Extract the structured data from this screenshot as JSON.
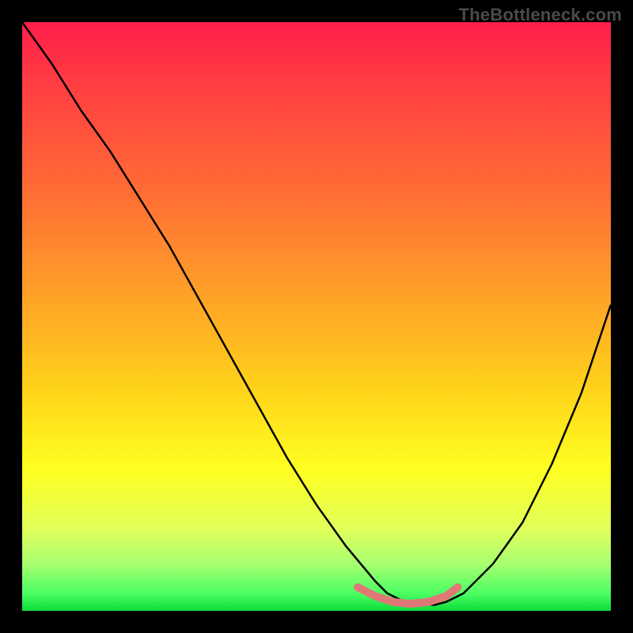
{
  "watermark": "TheBottleneck.com",
  "chart_data": {
    "type": "line",
    "title": "",
    "xlabel": "",
    "ylabel": "",
    "xlim": [
      0,
      100
    ],
    "ylim": [
      0,
      100
    ],
    "grid": false,
    "legend": false,
    "notes": "Axes, ticks and labels are not rendered; values estimated from pixel positions within the gradient plot area.",
    "series": [
      {
        "name": "bottleneck-curve",
        "x": [
          0,
          5,
          10,
          15,
          20,
          25,
          30,
          35,
          40,
          45,
          50,
          55,
          60,
          62,
          65,
          70,
          72,
          75,
          80,
          85,
          90,
          95,
          100
        ],
        "y": [
          100,
          93,
          85,
          78,
          70,
          62,
          53,
          44,
          35,
          26,
          18,
          11,
          5,
          3,
          1.5,
          1,
          1.5,
          3,
          8,
          15,
          25,
          37,
          52
        ]
      }
    ],
    "confidence_band": {
      "name": "optimal-range",
      "x": [
        57,
        60,
        63,
        66,
        69,
        72,
        74
      ],
      "y": [
        4,
        2.5,
        1.5,
        1.2,
        1.5,
        2.5,
        4
      ],
      "color": "#e07878"
    },
    "gradient": {
      "orientation": "vertical",
      "stops": [
        {
          "pos": 0.0,
          "color": "#ff1e4a"
        },
        {
          "pos": 0.1,
          "color": "#ff3c43"
        },
        {
          "pos": 0.28,
          "color": "#ff6a35"
        },
        {
          "pos": 0.46,
          "color": "#ffa028"
        },
        {
          "pos": 0.62,
          "color": "#ffd21a"
        },
        {
          "pos": 0.76,
          "color": "#ffff20"
        },
        {
          "pos": 0.86,
          "color": "#e1ff5a"
        },
        {
          "pos": 0.92,
          "color": "#a8ff70"
        },
        {
          "pos": 0.97,
          "color": "#4cff64"
        },
        {
          "pos": 1.0,
          "color": "#0bdc3c"
        }
      ]
    }
  }
}
